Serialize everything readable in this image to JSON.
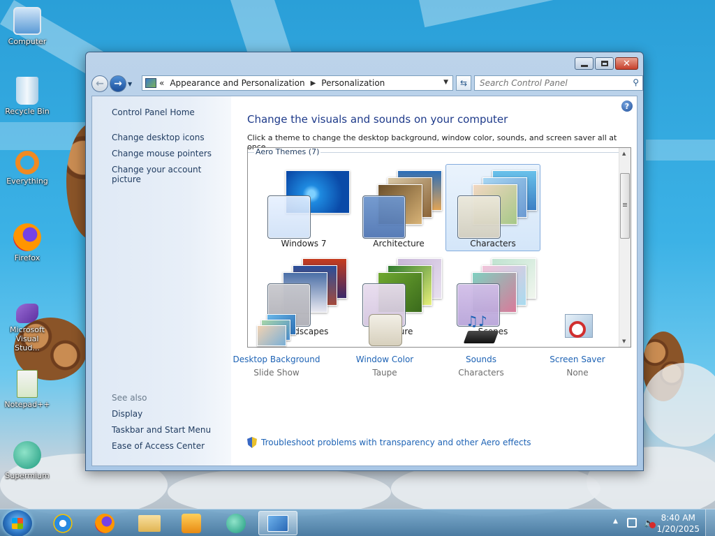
{
  "desktop": {
    "icons": [
      {
        "label": "Computer"
      },
      {
        "label": "Recycle Bin"
      },
      {
        "label": "Everything"
      },
      {
        "label": "Firefox"
      },
      {
        "label": "Microsoft Visual Stud..."
      },
      {
        "label": "Notepad++"
      },
      {
        "label": "Supermium"
      }
    ]
  },
  "window": {
    "address": {
      "overflow": "«",
      "crumbs": [
        "Appearance and Personalization",
        "Personalization"
      ]
    },
    "search": {
      "placeholder": "Search Control Panel"
    },
    "left_pane": {
      "home": "Control Panel Home",
      "links": [
        "Change desktop icons",
        "Change mouse pointers",
        "Change your account picture"
      ],
      "see_also": "See also",
      "see_also_links": [
        "Display",
        "Taskbar and Start Menu",
        "Ease of Access Center"
      ]
    },
    "main": {
      "help": "?",
      "title": "Change the visuals and sounds on your computer",
      "subtitle": "Click a theme to change the desktop background, window color, sounds, and screen saver all at once.",
      "group_label": "Aero Themes (7)",
      "themes": [
        {
          "name": "Windows 7",
          "selected": false
        },
        {
          "name": "Architecture",
          "selected": false
        },
        {
          "name": "Characters",
          "selected": true
        },
        {
          "name": "Landscapes",
          "selected": false
        },
        {
          "name": "Nature",
          "selected": false
        },
        {
          "name": "Scenes",
          "selected": false
        }
      ],
      "bottom": [
        {
          "label": "Desktop Background",
          "value": "Slide Show"
        },
        {
          "label": "Window Color",
          "value": "Taupe"
        },
        {
          "label": "Sounds",
          "value": "Characters"
        },
        {
          "label": "Screen Saver",
          "value": "None"
        }
      ],
      "troubleshoot": "Troubleshoot problems with transparency and other Aero effects"
    }
  },
  "taskbar": {
    "apps": [
      "internet-explorer",
      "firefox",
      "file-explorer",
      "media-player",
      "supermium",
      "control-panel"
    ],
    "clock": {
      "time": "8:40 AM",
      "date": "1/20/2025"
    }
  },
  "colors": {
    "link": "#1e63b5",
    "title": "#1e3a8a",
    "accent": "#84acdd"
  }
}
